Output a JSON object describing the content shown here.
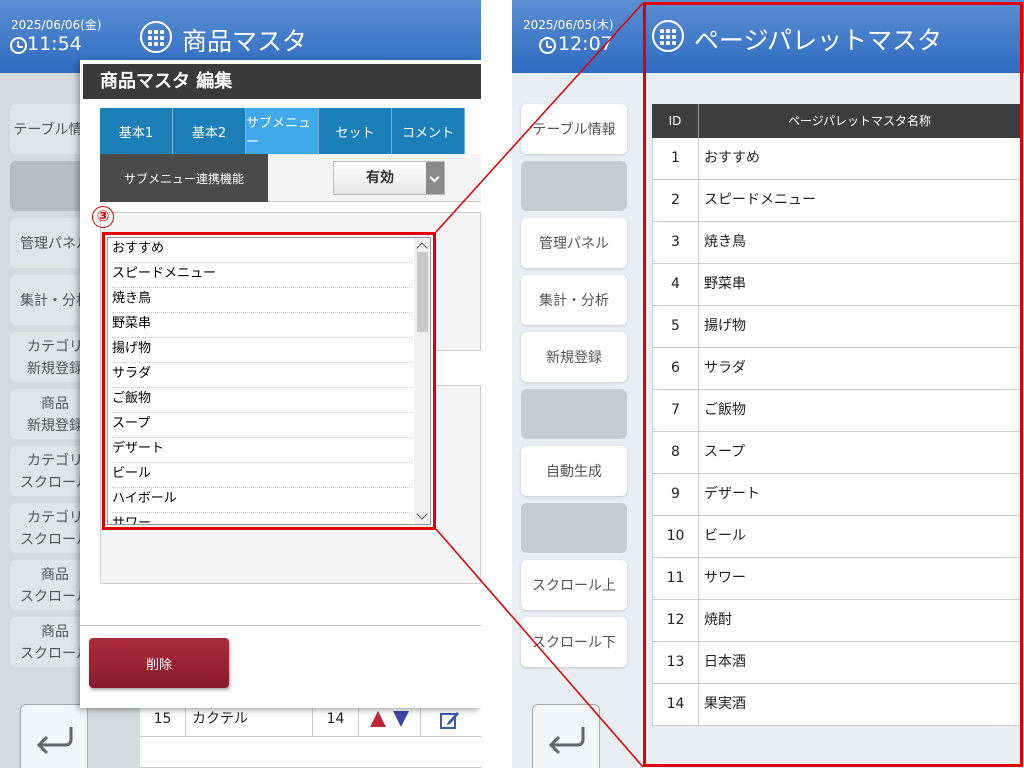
{
  "left": {
    "header": {
      "date": "2025/06/06(金)",
      "time": "11:54",
      "title": "商品マスタ"
    },
    "side_buttons": [
      {
        "label": "テーブル情報",
        "blank": false
      },
      {
        "label": "",
        "blank": true
      },
      {
        "label": "管理パネル",
        "blank": false
      },
      {
        "label": "集計・分析",
        "blank": false
      },
      {
        "label": "カテゴリ\n新規登録",
        "blank": false
      },
      {
        "label": "商品\n新規登録",
        "blank": false
      },
      {
        "label": "カテゴリ\nスクロール",
        "blank": false
      },
      {
        "label": "カテゴリ\nスクロール",
        "blank": false
      },
      {
        "label": "商品\nスクロール",
        "blank": false
      },
      {
        "label": "商品\nスクロール",
        "blank": false
      }
    ],
    "dialog": {
      "title": "商品マスタ 編集",
      "tabs": [
        "基本1",
        "基本2",
        "サブメニュー",
        "セット",
        "コメント"
      ],
      "active_tab": "サブメニュー",
      "feature_label": "サブメニュー連携機能",
      "select_value": "有効",
      "marker": "③",
      "list_items": [
        "おすすめ",
        "スピードメニュー",
        "焼き鳥",
        "野菜串",
        "揚げ物",
        "サラダ",
        "ご飯物",
        "スープ",
        "デザート",
        "ビール",
        "ハイボール",
        "サワー"
      ],
      "delete_label": "削除"
    },
    "bottom_row": {
      "id": "15",
      "name": "カクテル",
      "count": "14"
    }
  },
  "right": {
    "header": {
      "date": "2025/06/05(木)",
      "time": "12:07",
      "title": "ページパレットマスタ"
    },
    "side_buttons": [
      {
        "label": "テーブル情報",
        "blank": false
      },
      {
        "label": "",
        "blank": true
      },
      {
        "label": "管理パネル",
        "blank": false
      },
      {
        "label": "集計・分析",
        "blank": false
      },
      {
        "label": "新規登録",
        "blank": false
      },
      {
        "label": "",
        "blank": true
      },
      {
        "label": "自動生成",
        "blank": false
      },
      {
        "label": "",
        "blank": true
      },
      {
        "label": "スクロール上",
        "blank": false
      },
      {
        "label": "スクロール下",
        "blank": false
      }
    ],
    "table": {
      "headers": [
        "ID",
        "ページパレットマスタ名称"
      ],
      "rows": [
        {
          "id": "1",
          "name": "おすすめ"
        },
        {
          "id": "2",
          "name": "スピードメニュー"
        },
        {
          "id": "3",
          "name": "焼き鳥"
        },
        {
          "id": "4",
          "name": "野菜串"
        },
        {
          "id": "5",
          "name": "揚げ物"
        },
        {
          "id": "6",
          "name": "サラダ"
        },
        {
          "id": "7",
          "name": "ご飯物"
        },
        {
          "id": "8",
          "name": "スープ"
        },
        {
          "id": "9",
          "name": "デザート"
        },
        {
          "id": "10",
          "name": "ビール"
        },
        {
          "id": "11",
          "name": "サワー"
        },
        {
          "id": "12",
          "name": "焼酎"
        },
        {
          "id": "13",
          "name": "日本酒"
        },
        {
          "id": "14",
          "name": "果実酒"
        }
      ]
    }
  },
  "colors": {
    "header_blue": "#2f6bc0",
    "tab_blue": "#1d7fb8",
    "tab_active": "#3fa9ea",
    "highlight_red": "#e00000",
    "delete_red": "#8a1a2a"
  }
}
